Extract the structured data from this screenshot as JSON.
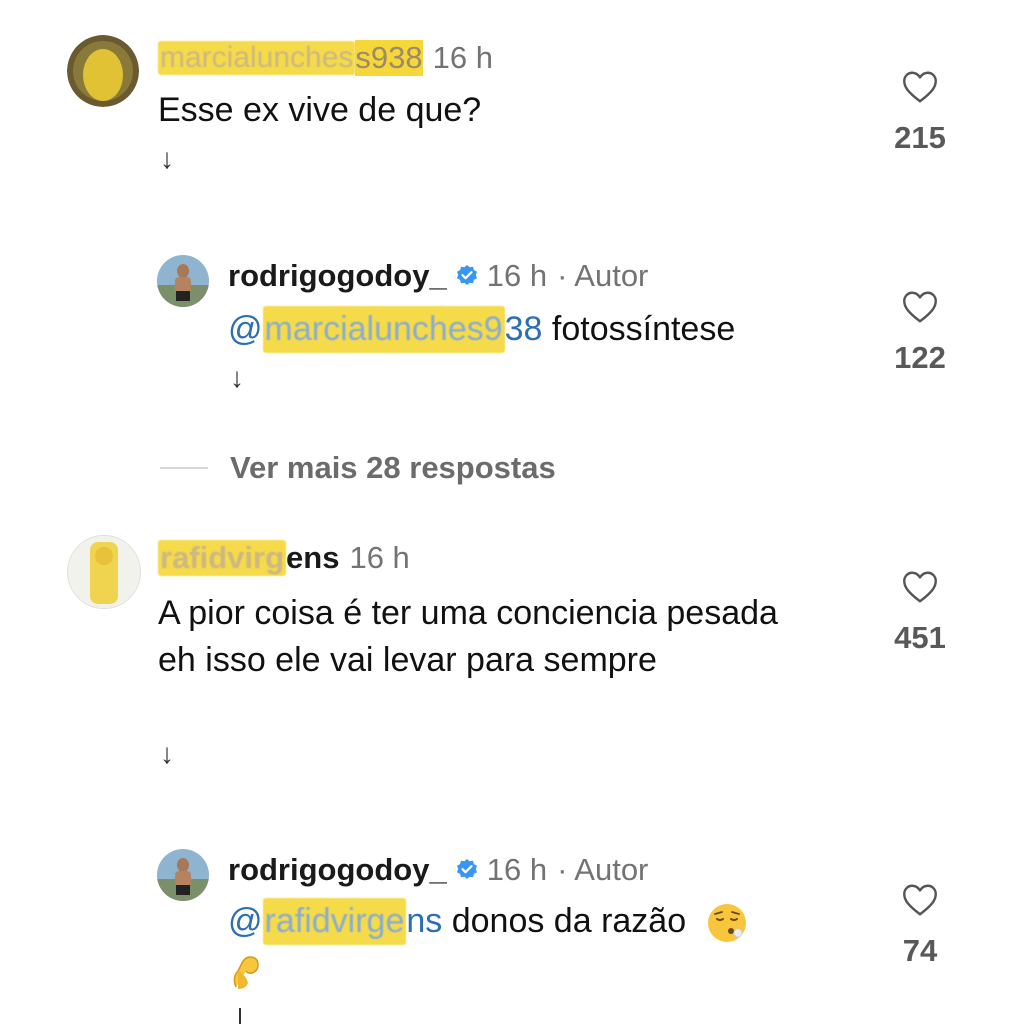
{
  "comments": [
    {
      "username_visible": "s938",
      "username_redacted": "marcialunches",
      "time": "16 h",
      "text": "Esse ex vive de que?",
      "reply_arrow": "↓",
      "likes": "215",
      "avatar_icon": "user-avatar-icon"
    },
    {
      "username": "rodrigogodoy_",
      "time": "16 h",
      "author_tag": "· Autor",
      "mention_prefix": "@",
      "mention_redacted": "marcialunches9",
      "mention_visible": "38",
      "text": " fotossíntese",
      "reply_arrow": "↓",
      "likes": "122",
      "avatar_icon": "author-avatar-icon"
    },
    {
      "username_redacted": "rafidvirg",
      "username_visible": "ens",
      "time": "16 h",
      "text": "A pior coisa é ter uma conciencia pesada eh isso ele vai levar para sempre",
      "reply_arrow": "↓",
      "likes": "451",
      "avatar_icon": "user-avatar-icon"
    },
    {
      "username": "rodrigogodoy_",
      "time": "16 h",
      "author_tag": "· Autor",
      "mention_prefix": "@",
      "mention_redacted": "rafidvirge",
      "mention_visible": "ns",
      "text": " donos da razão",
      "emoji_names": [
        "exhaling-face-emoji",
        "pinching-hand-emoji"
      ],
      "likes": "74",
      "avatar_icon": "author-avatar-icon"
    }
  ],
  "more_replies": "Ver mais 28 respostas",
  "colors": {
    "highlight": "#f5d73a",
    "mention": "#2c6fb3",
    "verified": "#3897f0",
    "meta": "#737373"
  }
}
